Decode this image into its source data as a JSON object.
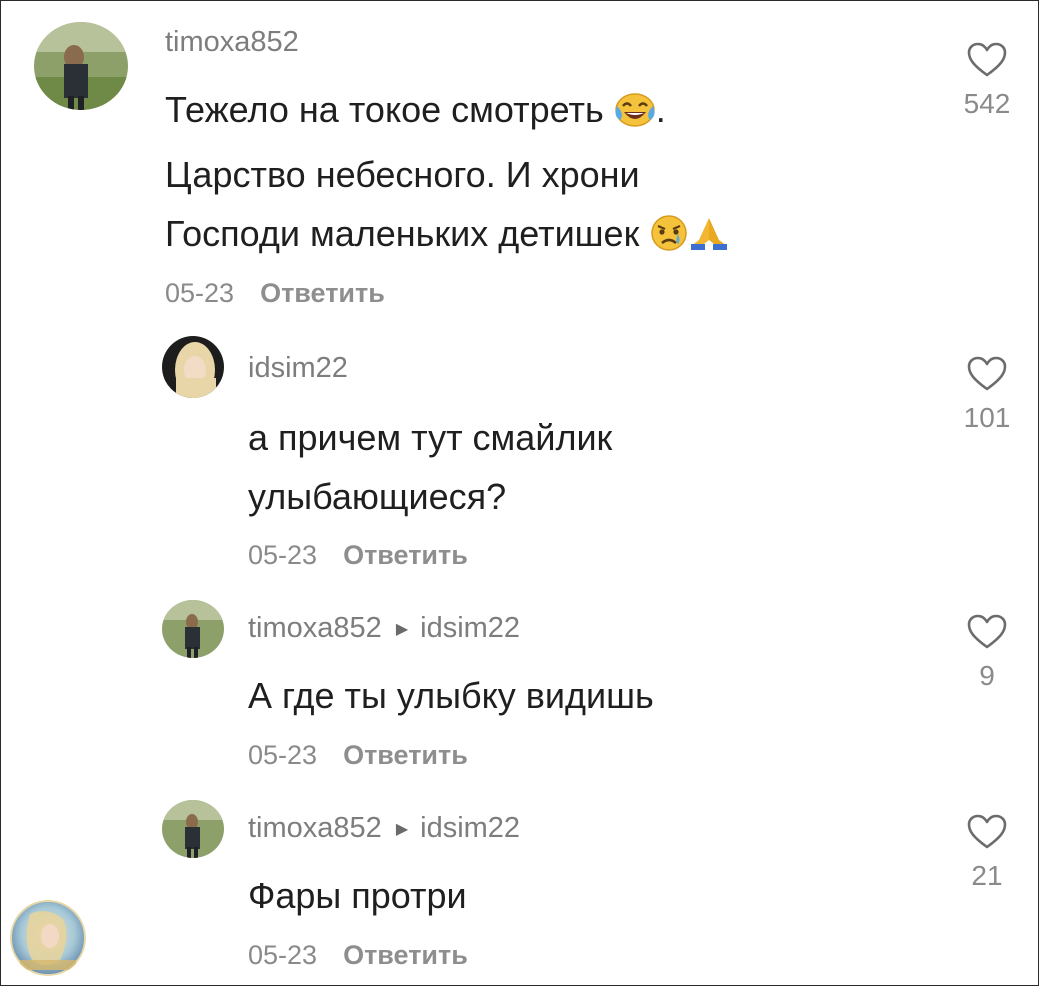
{
  "comments": [
    {
      "username": "timoxa852",
      "reply_to": "",
      "lines": [
        "Тежело на токое смотреть",
        "Царство небесного. И хрони",
        "Господи маленьких детишек"
      ],
      "date": "05-23",
      "reply_label": "Ответить",
      "likes": "542"
    },
    {
      "username": "idsim22",
      "reply_to": "",
      "lines": [
        "а причем тут смайлик",
        "улыбающиеся?"
      ],
      "date": "05-23",
      "reply_label": "Ответить",
      "likes": "101"
    },
    {
      "username": "timoxa852",
      "reply_to": "idsim22",
      "lines": [
        "А где ты улыбку видишь"
      ],
      "date": "05-23",
      "reply_label": "Ответить",
      "likes": "9"
    },
    {
      "username": "timoxa852",
      "reply_to": "idsim22",
      "lines": [
        "Фары протри"
      ],
      "date": "05-23",
      "reply_label": "Ответить",
      "likes": "21"
    }
  ],
  "icons": {
    "like": "heart-outline-icon",
    "reply_arrow": "triangle-right-icon",
    "emoji_laugh": "face-with-tears-of-joy",
    "emoji_cry": "crying-face",
    "emoji_pray": "folded-hands"
  },
  "colors": {
    "text": "#1f1f1f",
    "muted": "#8a8a8a",
    "emoji_yellow": "#f5c33b",
    "tear_blue": "#5aa9e6"
  }
}
